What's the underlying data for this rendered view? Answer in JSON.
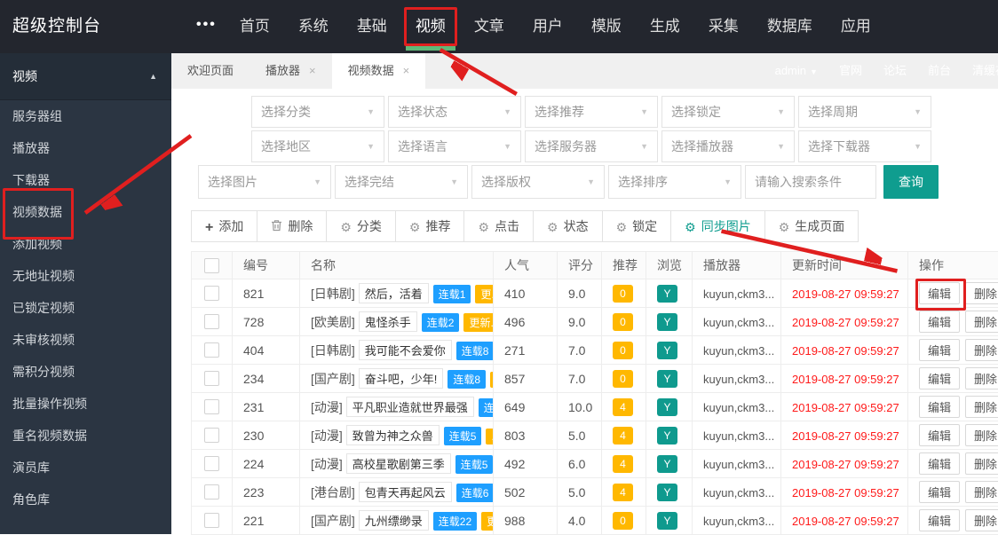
{
  "colors": {
    "accent_teal": "#0f9d8f",
    "badge_blue": "#1e9fff",
    "badge_orange": "#ffb800",
    "badge_teal": "#0f9a8e",
    "time_red": "#ff1a1a",
    "annotation_red": "#e01f1f",
    "nav_green": "#5fb878"
  },
  "topbar": {
    "logo": "超级控制台",
    "ellipsis": "•••",
    "items": [
      "首页",
      "系统",
      "基础",
      "视频",
      "文章",
      "用户",
      "模版",
      "生成",
      "采集",
      "数据库",
      "应用"
    ],
    "active_index": 3
  },
  "sidebar": {
    "header": "视频",
    "items": [
      "服务器组",
      "播放器",
      "下载器",
      "视频数据",
      "添加视频",
      "无地址视频",
      "已锁定视频",
      "未审核视频",
      "需积分视频",
      "批量操作视频",
      "重名视频数据",
      "演员库",
      "角色库"
    ],
    "annotated_index": 3
  },
  "tabbar": {
    "tabs": [
      {
        "label": "欢迎页面",
        "closable": false,
        "active": false
      },
      {
        "label": "播放器",
        "closable": true,
        "active": false
      },
      {
        "label": "视频数据",
        "closable": true,
        "active": true
      }
    ],
    "user_links": [
      "admin",
      "官网",
      "论坛",
      "前台",
      "清缓存"
    ]
  },
  "filters": {
    "row1": [
      "选择分类",
      "选择状态",
      "选择推荐",
      "选择锁定",
      "选择周期"
    ],
    "row2": [
      "选择地区",
      "选择语言",
      "选择服务器",
      "选择播放器",
      "选择下载器"
    ],
    "row3": [
      "选择图片",
      "选择完结",
      "选择版权",
      "选择排序"
    ],
    "search_placeholder": "请输入搜索条件",
    "query_label": "查询"
  },
  "toolbar": {
    "buttons": [
      {
        "icon": "plus",
        "label": "添加",
        "accent": false
      },
      {
        "icon": "trash",
        "label": "删除",
        "accent": false
      },
      {
        "icon": "gear",
        "label": "分类",
        "accent": false
      },
      {
        "icon": "gear",
        "label": "推荐",
        "accent": false
      },
      {
        "icon": "gear",
        "label": "点击",
        "accent": false
      },
      {
        "icon": "gear",
        "label": "状态",
        "accent": false
      },
      {
        "icon": "gear",
        "label": "锁定",
        "accent": false
      },
      {
        "icon": "gear",
        "label": "同步图片",
        "accent": true
      },
      {
        "icon": "gear",
        "label": "生成页面",
        "accent": false
      }
    ]
  },
  "table": {
    "headers": {
      "id": "编号",
      "name": "名称",
      "views": "人气",
      "score": "评分",
      "recommend": "推荐",
      "browse": "浏览",
      "player": "播放器",
      "updated": "更新时间",
      "ops": "操作"
    },
    "edit_label": "编辑",
    "delete_label": "删除",
    "rows": [
      {
        "id": "821",
        "category": "[日韩剧]",
        "title": "然后，活着",
        "serial": "连载1",
        "update": "更...",
        "views": "410",
        "score": "9.0",
        "recommend": "0",
        "browse": "Y",
        "player": "kuyun,ckm3...",
        "updated": "2019-08-27 09:59:27"
      },
      {
        "id": "728",
        "category": "[欧美剧]",
        "title": "鬼怪杀手",
        "serial": "连载2",
        "update": "更新...",
        "views": "496",
        "score": "9.0",
        "recommend": "0",
        "browse": "Y",
        "player": "kuyun,ckm3...",
        "updated": "2019-08-27 09:59:27"
      },
      {
        "id": "404",
        "category": "[日韩剧]",
        "title": "我可能不会爱你",
        "serial": "连载8",
        "update": "...",
        "views": "271",
        "score": "7.0",
        "recommend": "0",
        "browse": "Y",
        "player": "kuyun,ckm3...",
        "updated": "2019-08-27 09:59:27"
      },
      {
        "id": "234",
        "category": "[国产剧]",
        "title": "奋斗吧，少年!",
        "serial": "连载8",
        "update": "...",
        "views": "857",
        "score": "7.0",
        "recommend": "0",
        "browse": "Y",
        "player": "kuyun,ckm3...",
        "updated": "2019-08-27 09:59:27"
      },
      {
        "id": "231",
        "category": "[动漫]",
        "title": "平凡职业造就世界最强",
        "serial": "连...",
        "update": null,
        "views": "649",
        "score": "10.0",
        "recommend": "4",
        "browse": "Y",
        "player": "kuyun,ckm3...",
        "updated": "2019-08-27 09:59:27"
      },
      {
        "id": "230",
        "category": "[动漫]",
        "title": "致曾为神之众兽",
        "serial": "连载5",
        "update": "...",
        "views": "803",
        "score": "5.0",
        "recommend": "4",
        "browse": "Y",
        "player": "kuyun,ckm3...",
        "updated": "2019-08-27 09:59:27"
      },
      {
        "id": "224",
        "category": "[动漫]",
        "title": "高校星歌剧第三季",
        "serial": "连载5",
        "update": "...",
        "views": "492",
        "score": "6.0",
        "recommend": "4",
        "browse": "Y",
        "player": "kuyun,ckm3...",
        "updated": "2019-08-27 09:59:27"
      },
      {
        "id": "223",
        "category": "[港台剧]",
        "title": "包青天再起风云",
        "serial": "连载6",
        "update": "...",
        "views": "502",
        "score": "5.0",
        "recommend": "4",
        "browse": "Y",
        "player": "kuyun,ckm3...",
        "updated": "2019-08-27 09:59:27"
      },
      {
        "id": "221",
        "category": "[国产剧]",
        "title": "九州缥缈录",
        "serial": "连载22",
        "update": "更...",
        "views": "988",
        "score": "4.0",
        "recommend": "0",
        "browse": "Y",
        "player": "kuyun,ckm3...",
        "updated": "2019-08-27 09:59:27"
      }
    ]
  }
}
